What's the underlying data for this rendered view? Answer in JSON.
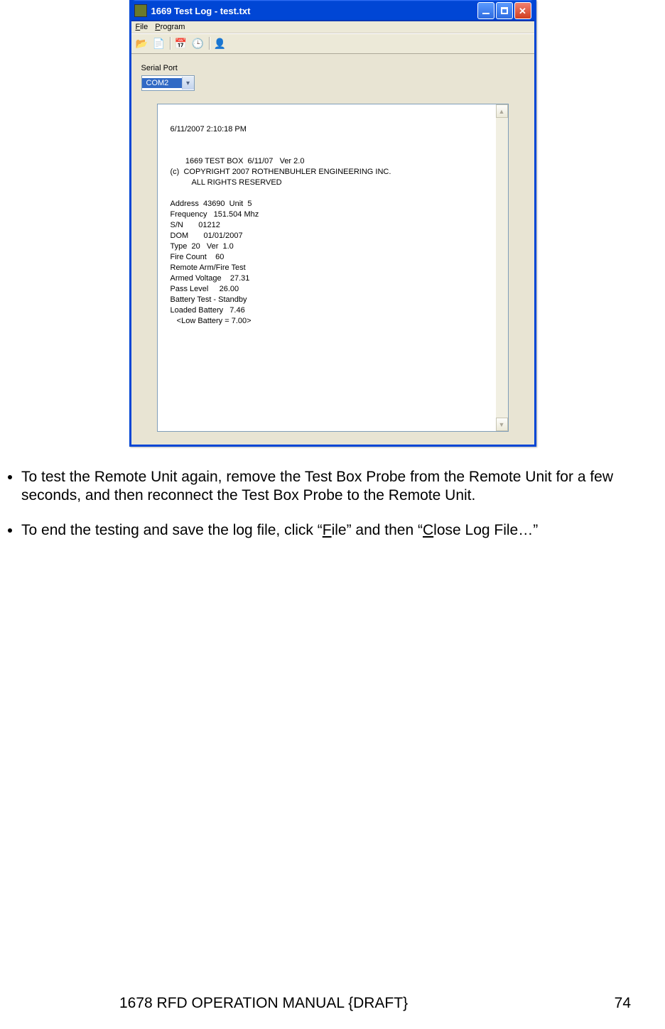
{
  "window": {
    "title": "1669 Test Log - test.txt",
    "menu": {
      "file": "File",
      "program": "Program"
    },
    "serial_label": "Serial Port",
    "serial_value": "COM2"
  },
  "log": {
    "timestamp": "6/11/2007 2:10:18 PM",
    "l1": "       1669 TEST BOX  6/11/07   Ver 2.0",
    "l2": "(c)  COPYRIGHT 2007 ROTHENBUHLER ENGINEERING INC.",
    "l3": "          ALL RIGHTS RESERVED",
    "l4": "Address  43690  Unit  5",
    "l5": "Frequency   151.504 Mhz",
    "l6": "S/N       01212",
    "l7": "DOM       01/01/2007",
    "l8": "Type  20   Ver  1.0",
    "l9": "Fire Count    60",
    "l10": "Remote Arm/Fire Test",
    "l11": "Armed Voltage    27.31",
    "l12": "Pass Level     26.00",
    "l13": "Battery Test - Standby",
    "l14": "Loaded Battery   7.46",
    "l15": "   <Low Battery = 7.00>"
  },
  "bullets": {
    "b1": "To test the Remote Unit again, remove the Test Box Probe from the Remote Unit for a few seconds, and then reconnect the Test Box Probe to the Remote Unit.",
    "b2a": "To end the testing and save the log file, click “",
    "b2u1": "F",
    "b2b": "ile” and then “",
    "b2u2": "C",
    "b2c": "lose Log File…”"
  },
  "footer": {
    "title": "1678 RFD OPERATION MANUAL {DRAFT}",
    "page": "74"
  }
}
